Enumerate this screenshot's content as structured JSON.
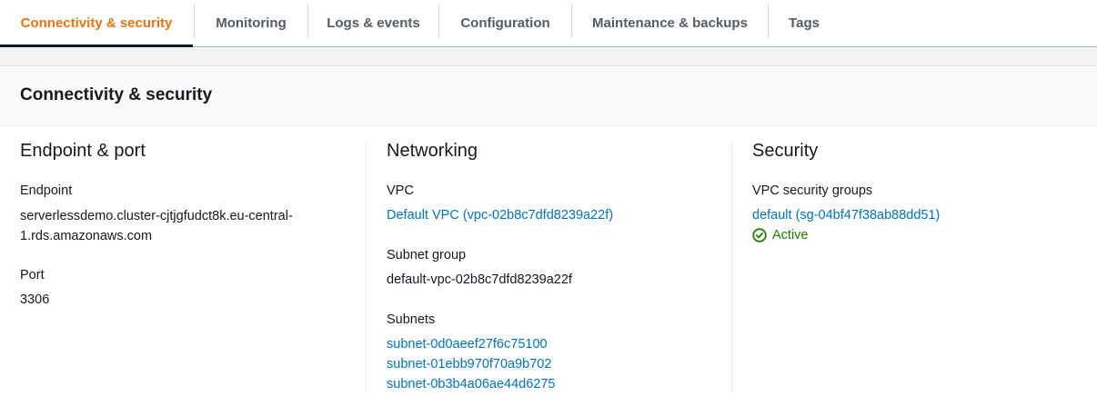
{
  "tabs": [
    {
      "label": "Connectivity & security",
      "active": true
    },
    {
      "label": "Monitoring"
    },
    {
      "label": "Logs & events"
    },
    {
      "label": "Configuration"
    },
    {
      "label": "Maintenance & backups"
    },
    {
      "label": "Tags"
    }
  ],
  "panel": {
    "title": "Connectivity & security"
  },
  "endpoint_port": {
    "title": "Endpoint & port",
    "endpoint_label": "Endpoint",
    "endpoint_line1": "serverlessdemo.cluster-cjtjgfudct8k.eu-central-",
    "endpoint_line2": "1.rds.amazonaws.com",
    "port_label": "Port",
    "port_value": "3306"
  },
  "networking": {
    "title": "Networking",
    "vpc_label": "VPC",
    "vpc_value": "Default VPC (vpc-02b8c7dfd8239a22f)",
    "subnet_group_label": "Subnet group",
    "subnet_group_value": "default-vpc-02b8c7dfd8239a22f",
    "subnets_label": "Subnets",
    "subnets": [
      "subnet-0d0aeef27f6c75100",
      "subnet-01ebb970f70a9b702",
      "subnet-0b3b4a06ae44d6275"
    ]
  },
  "security": {
    "title": "Security",
    "sg_label": "VPC security groups",
    "sg_value": "default (sg-04bf47f38ab88dd51)",
    "sg_status": "Active",
    "status_icon": "check-circle-icon"
  },
  "colors": {
    "accent": "#ec7211",
    "link": "#0073bb",
    "success": "#1d8102"
  }
}
